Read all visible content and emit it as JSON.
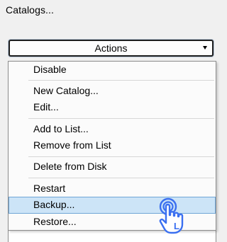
{
  "window": {
    "title": "Catalogs..."
  },
  "actions_button": {
    "label": "Actions"
  },
  "menu": {
    "items": [
      {
        "label": "Disable"
      },
      {
        "label": "New Catalog..."
      },
      {
        "label": "Edit..."
      },
      {
        "label": "Add to List..."
      },
      {
        "label": "Remove from List"
      },
      {
        "label": "Delete from Disk"
      },
      {
        "label": "Restart"
      },
      {
        "label": "Backup...",
        "state": "highlighted"
      },
      {
        "label": "Restore..."
      }
    ]
  },
  "cursor": {
    "icon": "hand-pointer-icon",
    "badge": "L"
  },
  "colors": {
    "highlight_fill": "#cce4f7",
    "highlight_border": "#6fa6d6",
    "cursor_accent": "#3a6ff0"
  }
}
